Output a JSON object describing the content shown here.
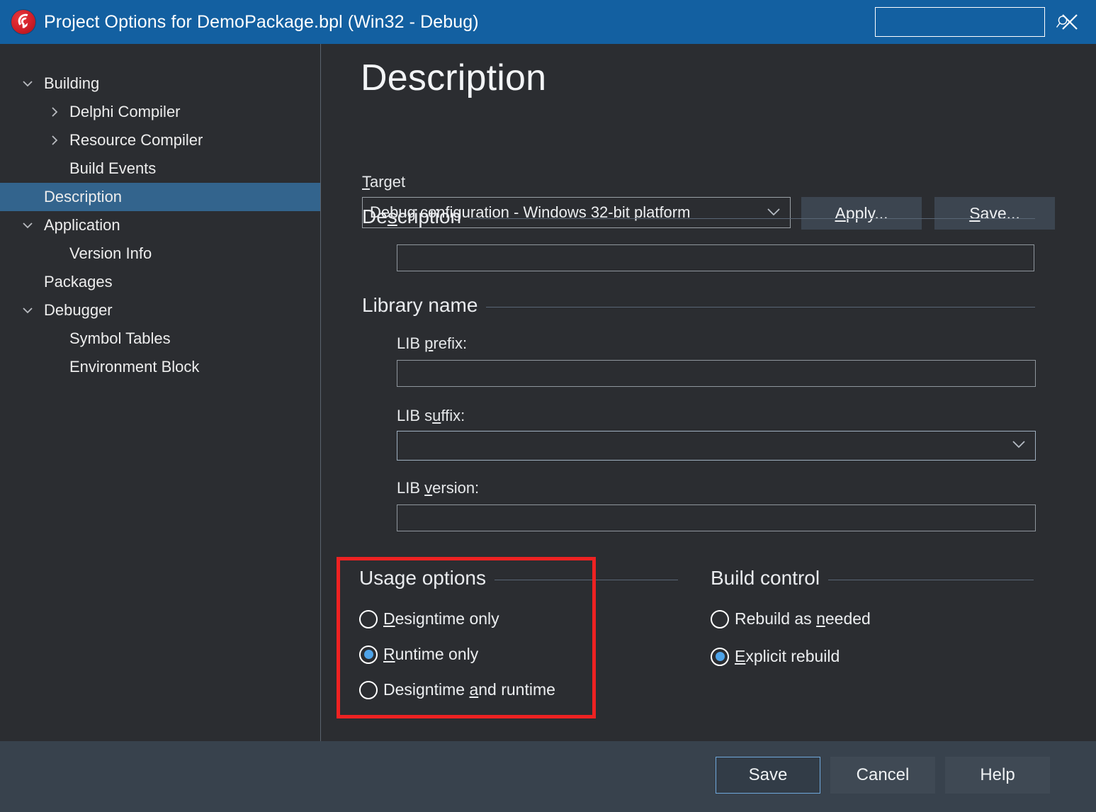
{
  "window": {
    "title": "Project Options for DemoPackage.bpl  (Win32 - Debug)",
    "app_icon": "delphi-helmet-icon",
    "close_icon": "close-icon",
    "titlebar_color": "#1360a1"
  },
  "search": {
    "value": "",
    "placeholder": "",
    "icon": "search-icon"
  },
  "sidebar": {
    "items": [
      {
        "label": "Building",
        "level": 0,
        "chevron": "chevron-down-icon",
        "selected": false
      },
      {
        "label": "Delphi Compiler",
        "level": 1,
        "chevron": "chevron-right-icon",
        "selected": false
      },
      {
        "label": "Resource Compiler",
        "level": 1,
        "chevron": "chevron-right-icon",
        "selected": false
      },
      {
        "label": "Build Events",
        "level": 1,
        "chevron": "",
        "selected": false
      },
      {
        "label": "Description",
        "level": 0,
        "chevron": "",
        "selected": true
      },
      {
        "label": "Application",
        "level": 0,
        "chevron": "chevron-down-icon",
        "selected": false
      },
      {
        "label": "Version Info",
        "level": 1,
        "chevron": "",
        "selected": false
      },
      {
        "label": "Packages",
        "level": 0,
        "chevron": "",
        "selected": false
      },
      {
        "label": "Debugger",
        "level": 0,
        "chevron": "chevron-down-icon",
        "selected": false
      },
      {
        "label": "Symbol Tables",
        "level": 1,
        "chevron": "",
        "selected": false
      },
      {
        "label": "Environment Block",
        "level": 1,
        "chevron": "",
        "selected": false
      }
    ],
    "selection_color": "#33648d"
  },
  "page": {
    "title": "Description"
  },
  "target": {
    "label_pre": "T",
    "label_post": "arget",
    "value": "Debug configuration - Windows 32-bit platform",
    "dropdown_icon": "chevron-down-icon",
    "apply_pre": "A",
    "apply_post": "pply...",
    "save_pre": "S",
    "save_post": "ave..."
  },
  "description_group": {
    "title_pre": "De",
    "title_mid": "s",
    "title_post": "cription",
    "value": "",
    "placeholder": ""
  },
  "library_group": {
    "title": "Library name",
    "lib_prefix": {
      "label_pre": "LIB ",
      "label_key": "p",
      "label_post": "refix:",
      "value": "",
      "placeholder": ""
    },
    "lib_suffix": {
      "label_pre": "LIB s",
      "label_key": "u",
      "label_post": "ffix:",
      "value": "",
      "dropdown_icon": "chevron-down-icon"
    },
    "lib_version": {
      "label_pre": "LIB ",
      "label_key": "v",
      "label_post": "ersion:",
      "value": "",
      "placeholder": ""
    }
  },
  "usage_options": {
    "title": "Usage options",
    "highlighted": true,
    "highlight_color": "#ee2222",
    "options": [
      {
        "pre": "",
        "key": "D",
        "post": "esigntime only",
        "selected": false
      },
      {
        "pre": "",
        "key": "R",
        "post": "untime only",
        "selected": true
      },
      {
        "pre": "Designtime ",
        "key": "a",
        "post": "nd runtime",
        "selected": false
      }
    ]
  },
  "build_control": {
    "title": "Build control",
    "options": [
      {
        "pre": "Rebuild as ",
        "key": "n",
        "post": "eeded",
        "selected": false
      },
      {
        "pre": "",
        "key": "E",
        "post": "xplicit rebuild",
        "selected": true
      }
    ]
  },
  "footer": {
    "save_label": "Save",
    "cancel_label": "Cancel",
    "help_label": "Help",
    "default_button": "Save"
  }
}
